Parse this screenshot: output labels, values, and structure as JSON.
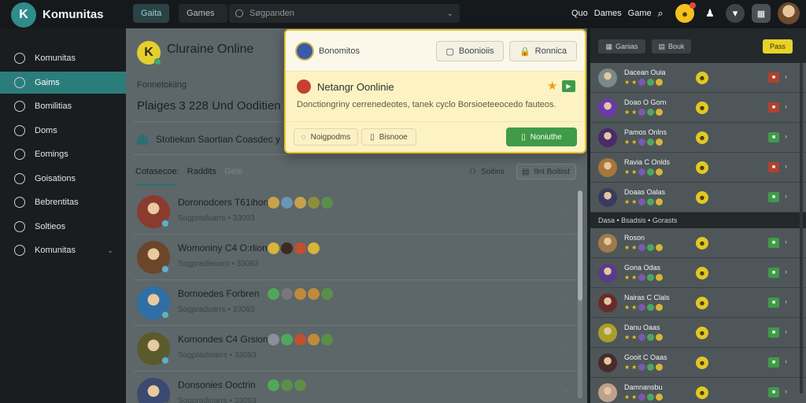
{
  "app": {
    "brand": "Komunitas",
    "logo_glyph": "K"
  },
  "topbar": {
    "tab1": "Gaita",
    "tab2": "Games",
    "search_placeholder": "Søgpanden",
    "links": [
      "Quo",
      "Dames",
      "Game"
    ]
  },
  "sidebar": {
    "items": [
      {
        "label": "Komunitas",
        "icon": "home-icon"
      },
      {
        "label": "Gaims",
        "icon": "chat-icon",
        "active": true
      },
      {
        "label": "Bomilitias",
        "icon": "info-icon"
      },
      {
        "label": "Doms",
        "icon": "dot-icon"
      },
      {
        "label": "Eomings",
        "icon": "clock-icon"
      },
      {
        "label": "Goisations",
        "icon": "target-icon"
      },
      {
        "label": "Bebrentitas",
        "icon": "users-icon"
      },
      {
        "label": "Soltieos",
        "icon": "calendar-icon"
      },
      {
        "label": "Komunitas",
        "icon": "settings-icon",
        "chevron": "⌄"
      }
    ]
  },
  "main": {
    "icon_glyph": "K",
    "title": "Cluraine Online",
    "subtitle1": "Fonnetokiing",
    "subtitle2": "Plaiges 3 228 Und Ooditien",
    "location": "Stotiekan Saortian Coasdec y",
    "tabs": [
      "Cotasecoe:",
      "Raddits",
      "Gele"
    ],
    "action1": "Soitins",
    "action2": "Ilnt Boitiist",
    "users": [
      {
        "name": "Doronodcers T61ihon",
        "meta": "Sogpraduarrs • 33093",
        "av": "#8a3b2e",
        "badges": [
          "#c8a24a",
          "#6c95b0",
          "#c8a24a",
          "#8f8d3a",
          "#5a8f4a"
        ]
      },
      {
        "name": "Womoniny C4 O:rlion",
        "meta": "Sogpradieoarn • 33093",
        "av": "#6b4628",
        "badges": [
          "#d9b43a",
          "#3d2a20",
          "#c05030",
          "#d9b43a"
        ]
      },
      {
        "name": "Bornoedes Forbren",
        "meta": "Sogpraduarrs • 33093",
        "av": "#2f6fa6",
        "badges": [
          "#4fa85a",
          "#777777",
          "#c08a3a",
          "#c08a3a",
          "#5a8f4a"
        ]
      },
      {
        "name": "Komondes C4 Grsion",
        "meta": "Sogpradioarrs • 33093",
        "av": "#5b5a2a",
        "badges": [
          "#8a8f9a",
          "#4fa85a",
          "#c05030",
          "#c08a3a",
          "#5a8f4a"
        ]
      },
      {
        "name": "Donsonies Ooctrin",
        "meta": "Sogpradioarrs • 33083",
        "av": "#3a4a70",
        "badges": [
          "#4fa85a",
          "#5a8f4a",
          "#5a8f4a"
        ]
      }
    ]
  },
  "popup": {
    "name": "Bonomitos",
    "btn1": "Boonioiis",
    "btn2": "Ronnica",
    "title": "Netangr Oonlinie",
    "desc": "Donctiongriny cerrenedeotes, tanek cyclo Borsioeteeocedo fauteos.",
    "btn_a": "Noigpodms",
    "btn_b": "Bisnooe",
    "btn_primary": "Noniuthe",
    "badge_glyph": "▶"
  },
  "right": {
    "btn1": "Ganias",
    "btn2": "Bouk",
    "btn3": "Pass",
    "section_label": "Dasa • Bsadsis • Gorasts",
    "rows_top": [
      {
        "name": "Dacean Ouia",
        "av": "#7a8a88",
        "box": "#b0422f"
      },
      {
        "name": "Doao O Gorn",
        "av": "#6b3aa8",
        "box": "#b0422f"
      },
      {
        "name": "Pamos Onlns",
        "av": "#4a2a6a",
        "box": "#3f9b48"
      },
      {
        "name": "Ravia C Onlds",
        "av": "#a8763a",
        "box": "#b0422f"
      },
      {
        "name": "Doaas Oalas",
        "av": "#3a3a60",
        "box": "#3f9b48"
      }
    ],
    "rows_bottom": [
      {
        "name": "Roson",
        "av": "#a07a4a",
        "box": "#3f9b48"
      },
      {
        "name": "Gona Odas",
        "av": "#5a3a8a",
        "box": "#3f9b48"
      },
      {
        "name": "Nairas C Clals",
        "av": "#6a2a2a",
        "box": "#3f9b48"
      },
      {
        "name": "Danu Oaas",
        "av": "#a8a02a",
        "box": "#3f9b48"
      },
      {
        "name": "Gooit C Oaas",
        "av": "#4a2a2a",
        "box": "#3f9b48"
      },
      {
        "name": "Damnansbu",
        "av": "#c0a08a",
        "box": "#3f9b48"
      }
    ]
  }
}
